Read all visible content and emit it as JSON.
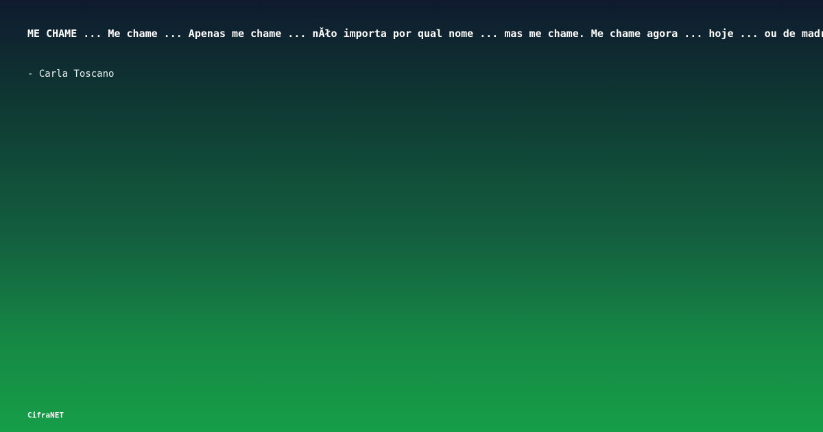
{
  "quote": {
    "text": "ME CHAME ... Me chame ... Apenas me chame ... nĂło importa por qual nome ... mas me chame. Me chame agora ... hoje ... ou de madrugada"
  },
  "author": {
    "text": "- Carla Toscano"
  },
  "brand": {
    "name": "CifraNET"
  }
}
